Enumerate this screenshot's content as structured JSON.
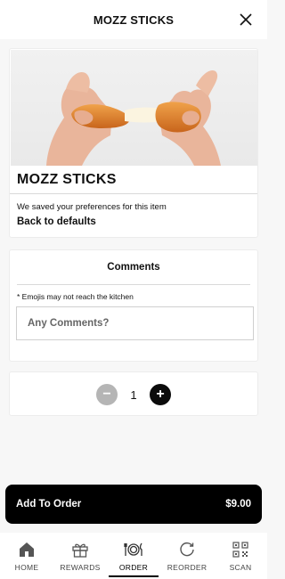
{
  "header": {
    "title": "MOZZ STICKS",
    "close_icon": "close-icon"
  },
  "item": {
    "name": "MOZZ STICKS",
    "preference_note": "We saved your preferences for this item",
    "back_to_defaults": "Back to defaults"
  },
  "comments": {
    "title": "Comments",
    "note": "* Emojis may not reach the kitchen",
    "value": "",
    "placeholder": "Any Comments?"
  },
  "quantity": {
    "minus": "−",
    "value": "1",
    "plus": "+"
  },
  "add_to_order": {
    "label": "Add To Order",
    "price": "$9.00"
  },
  "tabs": [
    {
      "label": "HOME",
      "icon": "home-icon",
      "active": false
    },
    {
      "label": "REWARDS",
      "icon": "gift-icon",
      "active": false
    },
    {
      "label": "ORDER",
      "icon": "plate-icon",
      "active": true
    },
    {
      "label": "REORDER",
      "icon": "reorder-icon",
      "active": false
    },
    {
      "label": "SCAN",
      "icon": "qr-code-icon",
      "active": false
    }
  ],
  "colors": {
    "accent": "#000000",
    "background": "#f7f7f7",
    "minus_button": "#b5b5b5"
  }
}
